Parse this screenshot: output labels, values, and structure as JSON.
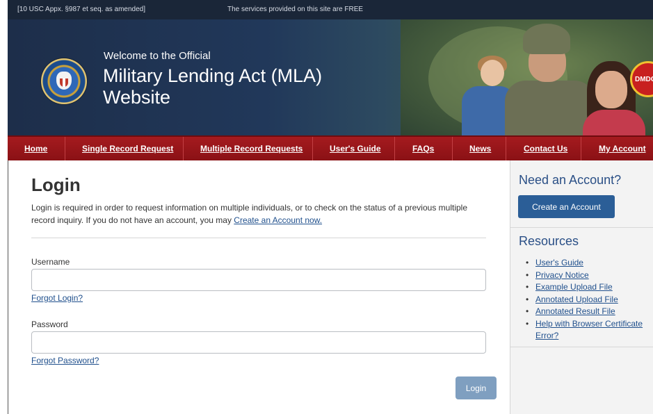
{
  "top_strip": {
    "left_text": "[10 USC Appx. §987 et seq. as amended]",
    "center_text": "The services provided on this site are FREE"
  },
  "banner": {
    "welcome": "Welcome to the Official",
    "title_line1": "Military Lending Act (MLA)",
    "title_line2": "Website",
    "logo_text": "DMDC"
  },
  "nav": {
    "items": [
      {
        "label": "Home"
      },
      {
        "label": "Single Record Request"
      },
      {
        "label": "Multiple Record Requests"
      },
      {
        "label": "User's Guide"
      },
      {
        "label": "FAQs"
      },
      {
        "label": "News"
      },
      {
        "label": "Contact Us"
      },
      {
        "label": "My Account"
      }
    ]
  },
  "login": {
    "title": "Login",
    "intro_text": "Login is required in order to request information on multiple individuals, or to check on the status of a previous multiple record inquiry. If you do not have an account, you may",
    "intro_link": "Create an Account now.",
    "username_label": "Username",
    "username_value": "",
    "forgot_login": "Forgot Login?",
    "password_label": "Password",
    "password_value": "",
    "forgot_password": "Forgot Password?",
    "submit_label": "Login"
  },
  "sidebar": {
    "need_account_heading": "Need an Account?",
    "create_button": "Create an Account",
    "resources_heading": "Resources",
    "resources": [
      {
        "label": "User's Guide"
      },
      {
        "label": "Privacy Notice"
      },
      {
        "label": "Example Upload File"
      },
      {
        "label": "Annotated Upload File"
      },
      {
        "label": "Annotated Result File"
      },
      {
        "label": "Help with Browser Certificate Error?"
      }
    ]
  },
  "colors": {
    "nav_red": "#9b171b",
    "banner_navy": "#1d2e4a",
    "link_blue": "#1f4f8c",
    "primary_button": "#2b5e97",
    "login_button": "#7f9fc0"
  }
}
